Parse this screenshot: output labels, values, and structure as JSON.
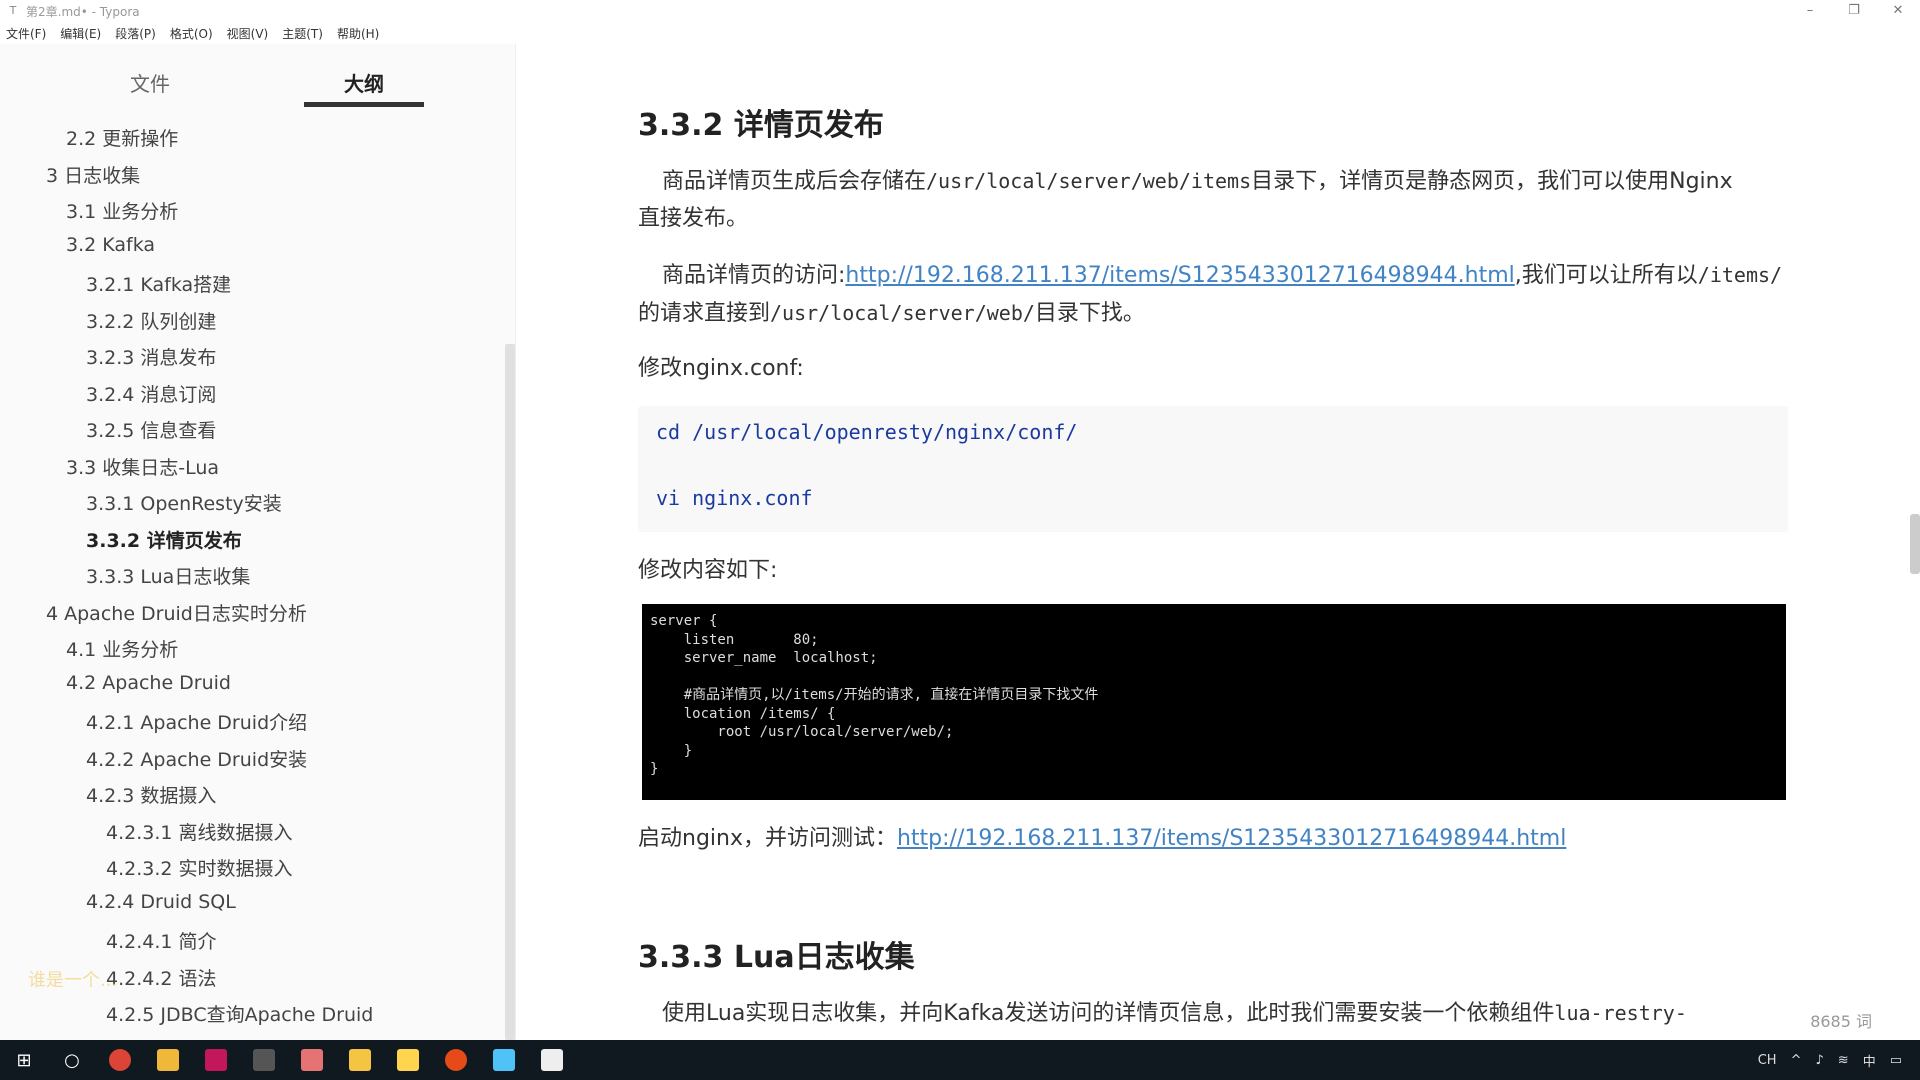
{
  "window": {
    "title": "第2章.md• - Typora",
    "minimize": "–",
    "restore": "❐",
    "close": "✕"
  },
  "menu": [
    "文件(F)",
    "编辑(E)",
    "段落(P)",
    "格式(O)",
    "视图(V)",
    "主题(T)",
    "帮助(H)"
  ],
  "sidebar": {
    "tabs": {
      "files": "文件",
      "outline": "大纲"
    },
    "outline": [
      {
        "label": "2.2 更新操作",
        "level": 2
      },
      {
        "label": "3 日志收集",
        "level": 1
      },
      {
        "label": "3.1 业务分析",
        "level": 2
      },
      {
        "label": "3.2 Kafka",
        "level": 2
      },
      {
        "label": "3.2.1 Kafka搭建",
        "level": 3
      },
      {
        "label": "3.2.2 队列创建",
        "level": 3
      },
      {
        "label": "3.2.3 消息发布",
        "level": 3
      },
      {
        "label": "3.2.4 消息订阅",
        "level": 3
      },
      {
        "label": "3.2.5 信息查看",
        "level": 3
      },
      {
        "label": "3.3 收集日志-Lua",
        "level": 2
      },
      {
        "label": "3.3.1 OpenResty安装",
        "level": 3
      },
      {
        "label": "3.3.2 详情页发布",
        "level": 3,
        "active": true
      },
      {
        "label": "3.3.3 Lua日志收集",
        "level": 3
      },
      {
        "label": "4 Apache Druid日志实时分析",
        "level": 1
      },
      {
        "label": "4.1 业务分析",
        "level": 2
      },
      {
        "label": "4.2 Apache Druid",
        "level": 2
      },
      {
        "label": "4.2.1 Apache Druid介绍",
        "level": 3
      },
      {
        "label": "4.2.2 Apache Druid安装",
        "level": 3
      },
      {
        "label": "4.2.3 数据摄入",
        "level": 3
      },
      {
        "label": "4.2.3.1 离线数据摄入",
        "level": 4
      },
      {
        "label": "4.2.3.2 实时数据摄入",
        "level": 4
      },
      {
        "label": "4.2.4 Druid SQL",
        "level": 3
      },
      {
        "label": "4.2.4.1 简介",
        "level": 4
      },
      {
        "label": "4.2.4.2 语法",
        "level": 4
      },
      {
        "label": "4.2.5 JDBC查询Apache Druid",
        "level": 4
      }
    ],
    "watermark": "谁是一个...",
    "footer": {
      "back": "‹",
      "source": "</>"
    }
  },
  "content": {
    "h_332": "3.3.2 详情页发布",
    "p1_a": "商品详情页生成后会存储在",
    "p1_code": "/usr/local/server/web/items",
    "p1_b": "目录下，详情页是静态网页，我们可以使用Nginx",
    "p1_c": "直接发布。",
    "p2_a": "商品详情页的访问:",
    "p2_link": "http://192.168.211.137/items/S1235433012716498944.html",
    "p2_b": ",我们可以让所有以",
    "p2_code1": "/items/",
    "p2_c": "的请求直接到",
    "p2_code2": "/usr/local/server/web/",
    "p2_d": "目录下找。",
    "p3": "修改nginx.conf:",
    "code_lines": [
      "cd /usr/local/openresty/nginx/conf/",
      "vi nginx.conf"
    ],
    "p4": "修改内容如下:",
    "terminal": "server {\n    listen       80;\n    server_name  localhost;\n\n    #商品详情页,以/items/开始的请求, 直接在详情页目录下找文件\n    location /items/ {\n        root /usr/local/server/web/;\n    }\n}",
    "p5_a": "启动nginx，并访问测试：",
    "p5_link": "http://192.168.211.137/items/S1235433012716498944.html",
    "h_333": "3.3.3 Lua日志收集",
    "p6_a": "使用Lua实现日志收集，并向Kafka发送访问的详情页信息，此时我们需要安装一个依赖组件",
    "p6_code": "lua-restry-"
  },
  "status": {
    "word_count": "8685 词"
  },
  "taskbar": {
    "start_icon": "windows-icon",
    "apps": [
      "search-icon",
      "chrome-icon",
      "typora-icon",
      "intellij-icon",
      "terminal-icon",
      "screen-icon",
      "folder-icon",
      "paint-icon",
      "recorder-icon",
      "explorer-icon",
      "notes-icon"
    ],
    "tray": {
      "lang": "CH",
      "ime": "中"
    }
  }
}
